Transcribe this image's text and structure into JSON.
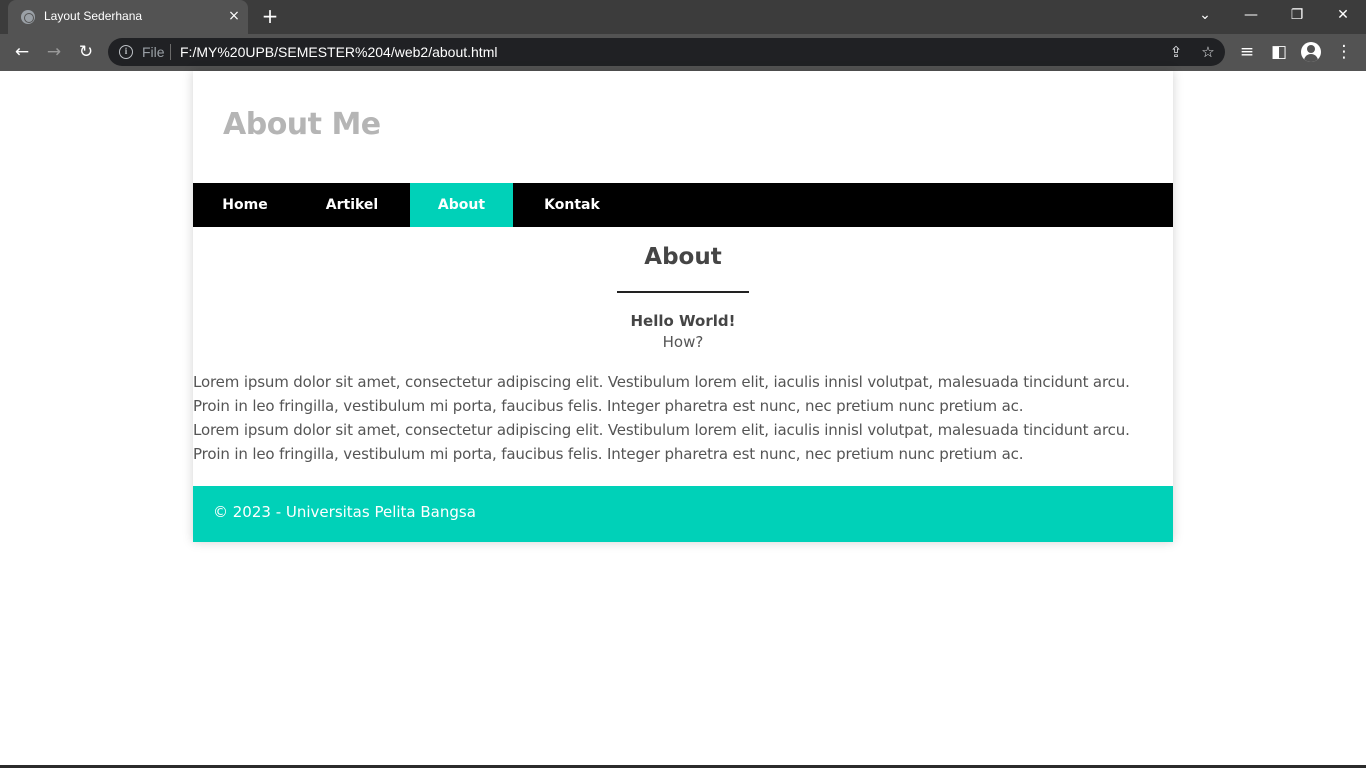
{
  "browser": {
    "tab_title": "Layout Sederhana",
    "tab_close_icon": "×",
    "new_tab_icon": "+",
    "scheme_label": "File",
    "url": "F:/MY%20UPB/SEMESTER%204/web2/about.html",
    "icons": {
      "back": "←",
      "forward": "→",
      "reload": "↻",
      "tab_search": "⌄",
      "minimize": "—",
      "restore": "❐",
      "close": "✕",
      "share": "⇪",
      "bookmark": "☆",
      "reading_list": "≡",
      "side_panel": "◧",
      "menu": "⋮"
    }
  },
  "site": {
    "header_title": "About Me",
    "nav": [
      {
        "label": "Home",
        "active": false
      },
      {
        "label": "Artikel",
        "active": false
      },
      {
        "label": "About",
        "active": true
      },
      {
        "label": "Kontak",
        "active": false
      }
    ],
    "section_title": "About",
    "hello": "Hello World!",
    "how": "How?",
    "paragraph_lines": [
      "Lorem ipsum dolor sit amet, consectetur adipiscing elit. Vestibulum lorem elit, iaculis innisl volutpat, malesuada tincidunt arcu.",
      "Proin in leo fringilla, vestibulum mi porta, faucibus felis. Integer pharetra est nunc, nec pretium nunc pretium ac.",
      "Lorem ipsum dolor sit amet, consectetur adipiscing elit. Vestibulum lorem elit, iaculis innisl volutpat, malesuada tincidunt arcu.",
      "Proin in leo fringilla, vestibulum mi porta, faucibus felis. Integer pharetra est nunc, nec pretium nunc pretium ac."
    ],
    "footer_text": "© 2023 - Universitas Pelita Bangsa"
  },
  "colors": {
    "accent": "#00d1b8",
    "nav_bg": "#000000",
    "header_title": "#b5b5b5",
    "text": "#555555"
  }
}
